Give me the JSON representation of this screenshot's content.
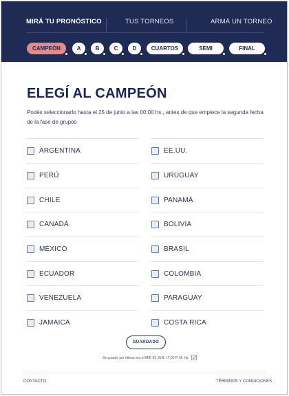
{
  "nav": {
    "mira": "MIRÁ TU PRONÓSTICO",
    "torneos": "TUS TORNEOS",
    "arma": "ARMÁ UN TORNEO"
  },
  "tabs": [
    "CAMPEÓN",
    "A",
    "B",
    "C",
    "D",
    "CUARTOS",
    "SEMI",
    "FINAL"
  ],
  "active_tab": "CAMPEÓN",
  "title": "ELEGÍ AL CAMPEÓN",
  "description": "Podés seleccionarlo hasta el 25 de junio a las 00:00 hs., antes de que empiece la segunda fecha de la fase de grupos",
  "teams_left": [
    "ARGENTINA",
    "PERÚ",
    "CHILE",
    "CANADÁ",
    "MÉXICO",
    "ECUADOR",
    "VENEZUELA",
    "JAMAICA"
  ],
  "teams_right": [
    "EE.UU.",
    "URUGUAY",
    "PANAMÁ",
    "BOLIVIA",
    "BRASIL",
    "COLOMBIA",
    "PARAGUAY",
    "COSTA RICA"
  ],
  "save_label": "GUARDADO",
  "saved_note": "Se guardó por última vez el MIÉ 05 JUN. / 7:02 P. M. Hs.",
  "footer": {
    "contact": "CONTACTO",
    "terms": "TÉRMINOS Y CONDICIONES"
  },
  "colors": {
    "navy": "#1f2a55",
    "accent": "#e58a8c",
    "checkbox": "#e8ecf6"
  }
}
